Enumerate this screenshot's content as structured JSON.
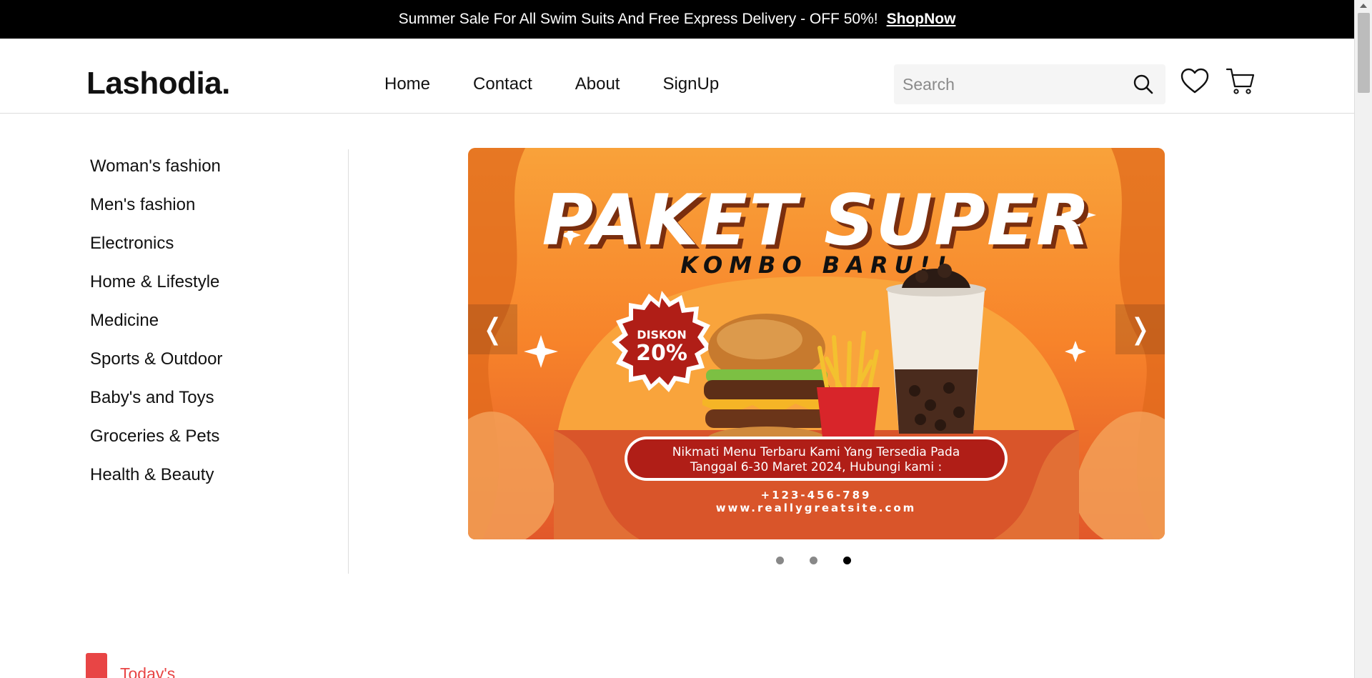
{
  "announcement": {
    "text": "Summer Sale For All Swim Suits And Free Express Delivery - OFF 50%!",
    "link": "ShopNow"
  },
  "header": {
    "logo": "Lashodia.",
    "nav": [
      "Home",
      "Contact",
      "About",
      "SignUp"
    ],
    "search_placeholder": "Search",
    "icons": [
      "search-icon",
      "heart-icon",
      "cart-icon"
    ]
  },
  "sidebar": {
    "items": [
      "Woman's fashion",
      "Men's fashion",
      "Electronics",
      "Home & Lifestyle",
      "Medicine",
      "Sports & Outdoor",
      "Baby's and Toys",
      "Groceries & Pets",
      "Health & Beauty"
    ]
  },
  "banner": {
    "title": "PAKET SUPER",
    "subtitle": "KOMBO BARU!!",
    "badge_top": "DISKON",
    "badge_value": "20%",
    "info_line1": "Nikmati Menu Terbaru Kami Yang Tersedia Pada",
    "info_line2": "Tanggal 6-30 Maret 2024, Hubungi kami :",
    "phone": "+123-456-789",
    "website": "www.reallygreatsite.com",
    "prev": "❬",
    "next": "❭",
    "slides": 3,
    "active_slide": 3,
    "colors": {
      "orange": "#f7931e",
      "dark_orange": "#e06a1c",
      "red": "#a81b17",
      "white": "#ffffff"
    }
  },
  "section": {
    "label": "Today's"
  }
}
